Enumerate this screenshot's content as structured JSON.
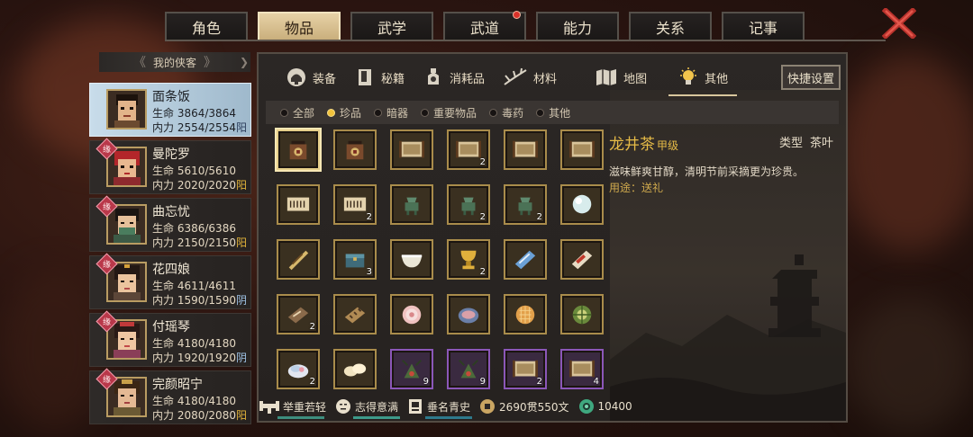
{
  "top_tabs": [
    {
      "label": "角色",
      "active": false,
      "dot": false
    },
    {
      "label": "物品",
      "active": true,
      "dot": false
    },
    {
      "label": "武学",
      "active": false,
      "dot": false
    },
    {
      "label": "武道",
      "active": false,
      "dot": true
    },
    {
      "label": "能力",
      "active": false,
      "dot": false
    },
    {
      "label": "关系",
      "active": false,
      "dot": false
    },
    {
      "label": "记事",
      "active": false,
      "dot": false
    }
  ],
  "close_icon": "close-x-icon",
  "sidebar": {
    "title": "我的侠客",
    "characters": [
      {
        "name": "面条饭",
        "hp_label": "生命",
        "hp": "3864/3864",
        "mp_label": "内力",
        "mp": "2554/2554",
        "yinyang": "阳",
        "bond": "",
        "active": true
      },
      {
        "name": "曼陀罗",
        "hp_label": "生命",
        "hp": "5610/5610",
        "mp_label": "内力",
        "mp": "2020/2020",
        "yinyang": "阳",
        "bond": "缘",
        "active": false
      },
      {
        "name": "曲忘忧",
        "hp_label": "生命",
        "hp": "6386/6386",
        "mp_label": "内力",
        "mp": "2150/2150",
        "yinyang": "阳",
        "bond": "缘",
        "active": false
      },
      {
        "name": "花四娘",
        "hp_label": "生命",
        "hp": "4611/4611",
        "mp_label": "内力",
        "mp": "1590/1590",
        "yinyang": "阴",
        "bond": "缘",
        "active": false
      },
      {
        "name": "付瑶琴",
        "hp_label": "生命",
        "hp": "4180/4180",
        "mp_label": "内力",
        "mp": "1920/1920",
        "yinyang": "阴",
        "bond": "缘",
        "active": false
      },
      {
        "name": "完颜昭宁",
        "hp_label": "生命",
        "hp": "4180/4180",
        "mp_label": "内力",
        "mp": "2080/2080",
        "yinyang": "阳",
        "bond": "缘",
        "active": false
      }
    ]
  },
  "category_tabs": [
    {
      "label": "装备",
      "icon": "helmet-icon",
      "active": false
    },
    {
      "label": "秘籍",
      "icon": "book-icon",
      "active": false
    },
    {
      "label": "消耗品",
      "icon": "potion-icon",
      "active": false
    },
    {
      "label": "材料",
      "icon": "herb-icon",
      "active": false
    },
    {
      "label": "地图",
      "icon": "map-icon",
      "active": false
    },
    {
      "label": "其他",
      "icon": "bulb-icon",
      "active": true
    }
  ],
  "quick_settings": "快捷设置",
  "filters": [
    {
      "label": "全部",
      "on": false
    },
    {
      "label": "珍品",
      "on": true
    },
    {
      "label": "暗器",
      "on": false
    },
    {
      "label": "重要物品",
      "on": false
    },
    {
      "label": "毒药",
      "on": false
    },
    {
      "label": "其他",
      "on": false
    }
  ],
  "items": [
    {
      "icon": "tea-jar-icon",
      "count": "",
      "rarity": "gold",
      "selected": true
    },
    {
      "icon": "tea-jar-icon",
      "count": "",
      "rarity": "gold",
      "selected": false
    },
    {
      "icon": "scroll-painting-icon",
      "count": "",
      "rarity": "gold",
      "selected": false
    },
    {
      "icon": "scroll-painting-icon",
      "count": "2",
      "rarity": "gold",
      "selected": false
    },
    {
      "icon": "scroll-painting-icon",
      "count": "",
      "rarity": "gold",
      "selected": false
    },
    {
      "icon": "scroll-painting-icon",
      "count": "",
      "rarity": "gold",
      "selected": false
    },
    {
      "icon": "calligraphy-icon",
      "count": "",
      "rarity": "gold",
      "selected": false
    },
    {
      "icon": "calligraphy-icon",
      "count": "2",
      "rarity": "gold",
      "selected": false
    },
    {
      "icon": "bronze-vessel-icon",
      "count": "",
      "rarity": "gold",
      "selected": false
    },
    {
      "icon": "bronze-vessel-icon",
      "count": "2",
      "rarity": "gold",
      "selected": false
    },
    {
      "icon": "bronze-vessel-icon",
      "count": "2",
      "rarity": "gold",
      "selected": false
    },
    {
      "icon": "pearl-icon",
      "count": "",
      "rarity": "gold",
      "selected": false
    },
    {
      "icon": "rolled-scroll-icon",
      "count": "",
      "rarity": "gold",
      "selected": false
    },
    {
      "icon": "chest-icon",
      "count": "3",
      "rarity": "gold",
      "selected": false
    },
    {
      "icon": "bowl-icon",
      "count": "",
      "rarity": "gold",
      "selected": false
    },
    {
      "icon": "gold-cup-icon",
      "count": "2",
      "rarity": "gold",
      "selected": false
    },
    {
      "icon": "blue-book-icon",
      "count": "",
      "rarity": "gold",
      "selected": false
    },
    {
      "icon": "red-book-icon",
      "count": "",
      "rarity": "gold",
      "selected": false
    },
    {
      "icon": "brown-book-icon",
      "count": "2",
      "rarity": "gold",
      "selected": false
    },
    {
      "icon": "wood-board-icon",
      "count": "",
      "rarity": "gold",
      "selected": false
    },
    {
      "icon": "pastry-icon",
      "count": "",
      "rarity": "gold",
      "selected": false
    },
    {
      "icon": "dish-icon",
      "count": "",
      "rarity": "gold",
      "selected": false
    },
    {
      "icon": "bun-icon",
      "count": "",
      "rarity": "gold",
      "selected": false
    },
    {
      "icon": "melon-icon",
      "count": "",
      "rarity": "gold",
      "selected": false
    },
    {
      "icon": "plate-icon",
      "count": "2",
      "rarity": "gold",
      "selected": false
    },
    {
      "icon": "dumpling-icon",
      "count": "",
      "rarity": "gold",
      "selected": false
    },
    {
      "icon": "herb-bundle-icon",
      "count": "9",
      "rarity": "purple",
      "selected": false
    },
    {
      "icon": "herb-bundle-icon",
      "count": "9",
      "rarity": "purple",
      "selected": false
    },
    {
      "icon": "scroll-painting-icon",
      "count": "2",
      "rarity": "purple",
      "selected": false
    },
    {
      "icon": "scroll-painting-icon",
      "count": "4",
      "rarity": "purple",
      "selected": false
    }
  ],
  "detail": {
    "name": "龙井茶",
    "grade": "甲级",
    "type_label": "类型",
    "type_value": "茶叶",
    "description": "滋味鲜爽甘醇，清明节前采摘更为珍贵。",
    "use": "用途：送礼"
  },
  "status_bar": [
    {
      "icon": "strength-icon",
      "label": "举重若轻"
    },
    {
      "icon": "face-icon",
      "label": "志得意满"
    },
    {
      "icon": "plaque-icon",
      "label": "垂名青史"
    },
    {
      "icon": "copper-coin-icon",
      "label": "2690贯550文"
    },
    {
      "icon": "jade-coin-icon",
      "label": "10400"
    }
  ],
  "colors": {
    "gold": "#a98c4b",
    "purple": "#8b57b8",
    "accent": "#e6bb47",
    "yang": "#e2b33a",
    "yin": "#9fc3e6"
  }
}
